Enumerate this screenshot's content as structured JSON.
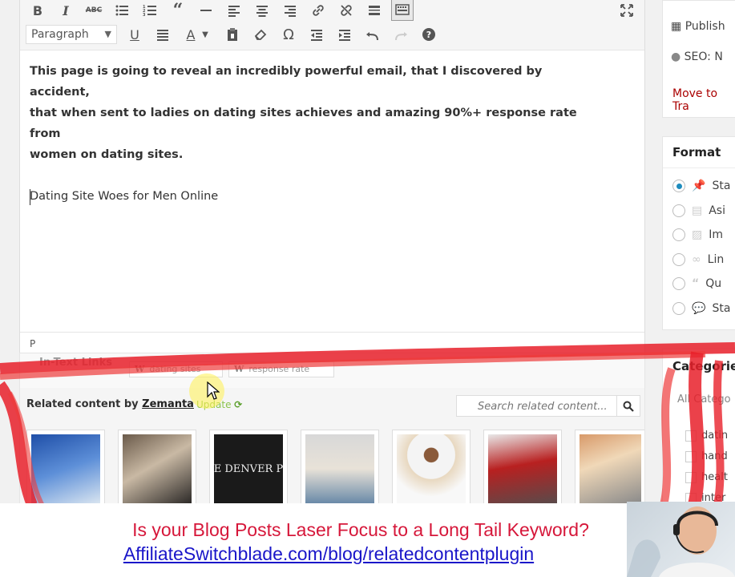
{
  "toolbar": {
    "paragraph_select": "Paragraph"
  },
  "editor": {
    "paragraphs": [
      "This page is going to reveal an incredibly powerful email, that I discovered by accident,",
      "that when sent to ladies on dating sites achieves and amazing 90%+ response rate from",
      "women on dating sites."
    ],
    "heading_line": "Dating Site Woes for Men Online",
    "path": "P"
  },
  "intext_links": {
    "title": "In-Text Links",
    "keywords": [
      "dating sites",
      "response rate"
    ]
  },
  "related": {
    "title_prefix": "Related content by",
    "brand": "Zemanta",
    "update_label": "Update",
    "search_placeholder": "Search related content...",
    "thumb_3_text": "E DENVER P"
  },
  "sidebar": {
    "publish_rows": [
      "Publish",
      "SEO: N"
    ],
    "move_to_trash": "Move to Tra",
    "format_title": "Format",
    "format_options": [
      "Sta",
      "Asi",
      "Im",
      "Lin",
      "Qu",
      "Sta"
    ],
    "categories_title": "Categories",
    "categories_tab": "All Catego",
    "categories": [
      "datin",
      "hand",
      "healt",
      "inter"
    ]
  },
  "banner": {
    "line1": "Is your Blog Posts Laser Focus to a Long Tail Keyword?",
    "line2": "AffiliateSwitchblade.com/blog/relatedcontentplugin"
  }
}
